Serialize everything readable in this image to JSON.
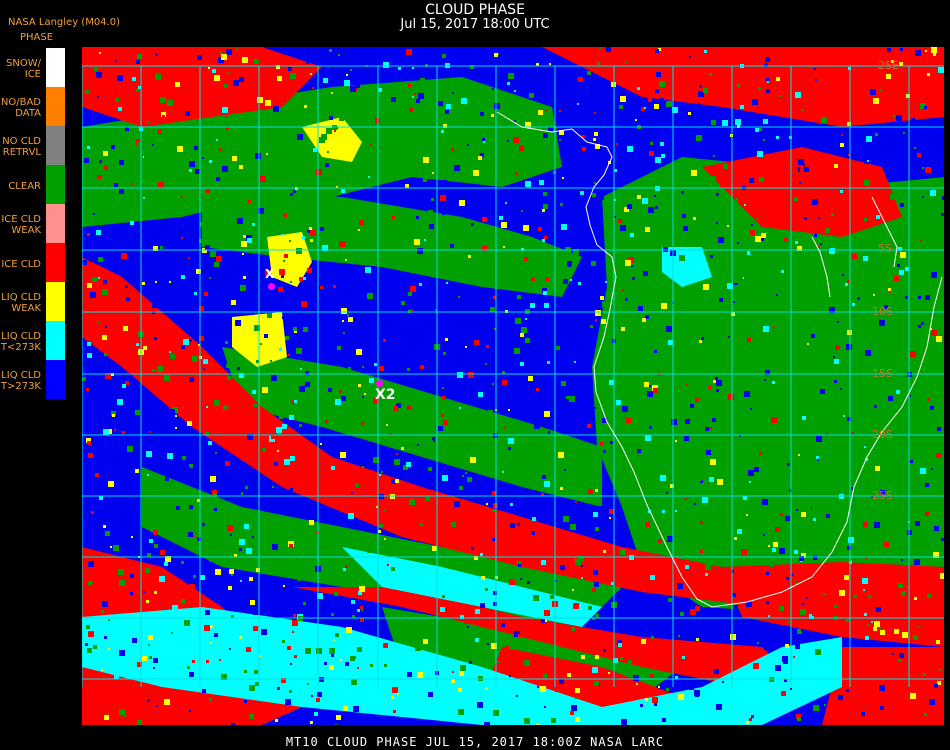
{
  "header": {
    "title": "CLOUD PHASE",
    "subtitle": "Jul 15, 2017 18:00 UTC",
    "producer": "NASA Langley (M04.0)"
  },
  "legend": {
    "title": "PHASE",
    "items": [
      {
        "label": "SNOW/\nICE",
        "color": "#ffffff"
      },
      {
        "label": "NO/BAD\nDATA",
        "color": "#ff8000"
      },
      {
        "label": "NO CLD\nRETRVL",
        "color": "#808080"
      },
      {
        "label": "CLEAR",
        "color": "#00a000"
      },
      {
        "label": "ICE CLD\nWEAK",
        "color": "#ff9090"
      },
      {
        "label": "ICE CLD",
        "color": "#ff0000"
      },
      {
        "label": "LIQ CLD\nWEAK",
        "color": "#ffff00"
      },
      {
        "label": "LIQ CLD\nT<273K",
        "color": "#00ffff"
      },
      {
        "label": "LIQ CLD\nT>273K",
        "color": "#0000ff"
      }
    ]
  },
  "map": {
    "lat_labels": [
      "25E",
      "5S",
      "10S",
      "15S",
      "20S",
      "25S"
    ],
    "markers": [
      {
        "label": "X"
      },
      {
        "label": "X2"
      }
    ],
    "colors": {
      "clear": "#00a000",
      "ice": "#ff0000",
      "liq_warm": "#0000f0",
      "liq_cold": "#00ffff",
      "liq_weak": "#ffff00",
      "grid": "#00e0e0",
      "coast": "#ffffff",
      "marker": "#ff00ff"
    }
  },
  "footer": {
    "text": "MT10  CLOUD PHASE   JUL 15, 2017 18:00Z   NASA LARC"
  }
}
